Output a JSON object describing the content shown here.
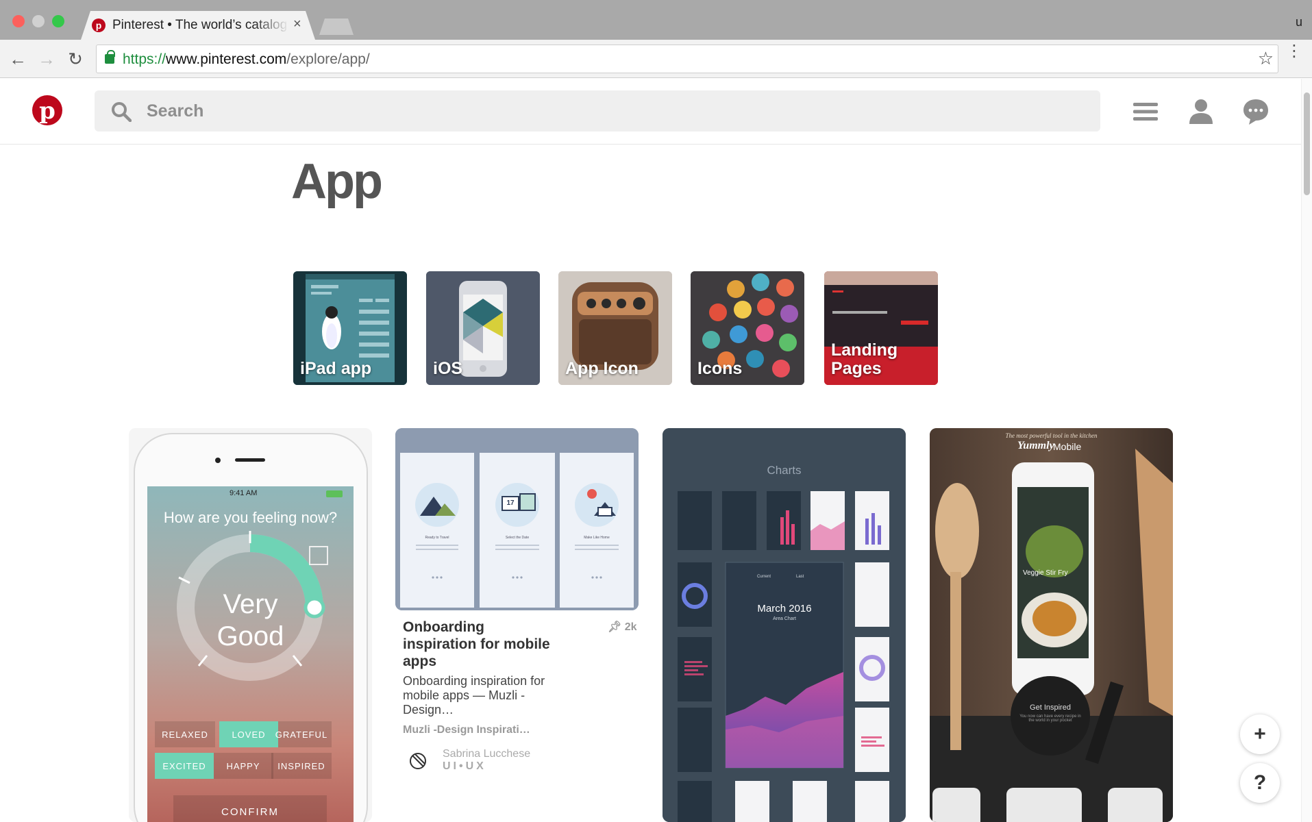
{
  "browser": {
    "tab_title": "Pinterest • The world’s catalog of ideas",
    "tab_close": "×",
    "user_initial": "u",
    "url_scheme": "https://",
    "url_host": "www.pinterest.com",
    "url_path": "/explore/app/",
    "back": "←",
    "forward": "→",
    "reload": "↻",
    "star": "☆",
    "menu": "⋮"
  },
  "header": {
    "logo": "p",
    "search_placeholder": "Search"
  },
  "page": {
    "title": "App"
  },
  "topics": [
    {
      "label": "iPad app"
    },
    {
      "label": "iOS"
    },
    {
      "label": "App Icon"
    },
    {
      "label": "Icons"
    },
    {
      "label": "Landing Pages"
    }
  ],
  "pins": {
    "mood": {
      "time": "9:41 AM",
      "question": "How are you feeling now?",
      "dial_line1": "Very",
      "dial_line2": "Good",
      "options": [
        "RELAXED",
        "LOVED",
        "GRATEFUL",
        "EXCITED",
        "HAPPY",
        "INSPIRED"
      ],
      "confirm": "CONFIRM"
    },
    "onboarding": {
      "screen_titles": [
        "Ready to Travel",
        "Select the Date",
        "Make Like Home"
      ],
      "calendar_day": "17",
      "title": "Onboarding inspiration for mobile apps",
      "save_count": "2k",
      "description": "Onboarding inspiration for mobile apps — Muzli - Design…",
      "source": "Muzli -Design Inspirati…",
      "pinner_name": "Sabrina Lucchese",
      "pinner_board": "UI•UX"
    },
    "charts": {
      "heading": "Charts",
      "month": "March 2016",
      "subtitle": "Area Chart",
      "legend_current": "Current",
      "legend_last": "Last"
    },
    "yummly": {
      "tagline": "The most powerful tool in the kitchen",
      "brand": "Yummly",
      "brand_suffix": "Mobile",
      "dish": "Veggie Stir Fry",
      "cta": "Get Inspired",
      "cta_sub": "You now can have every recipe in the world in your pocket"
    }
  },
  "floating": {
    "add": "+",
    "help": "?"
  },
  "colors": {
    "pinterest_red": "#bd081c",
    "mint": "#6fd3b5"
  }
}
